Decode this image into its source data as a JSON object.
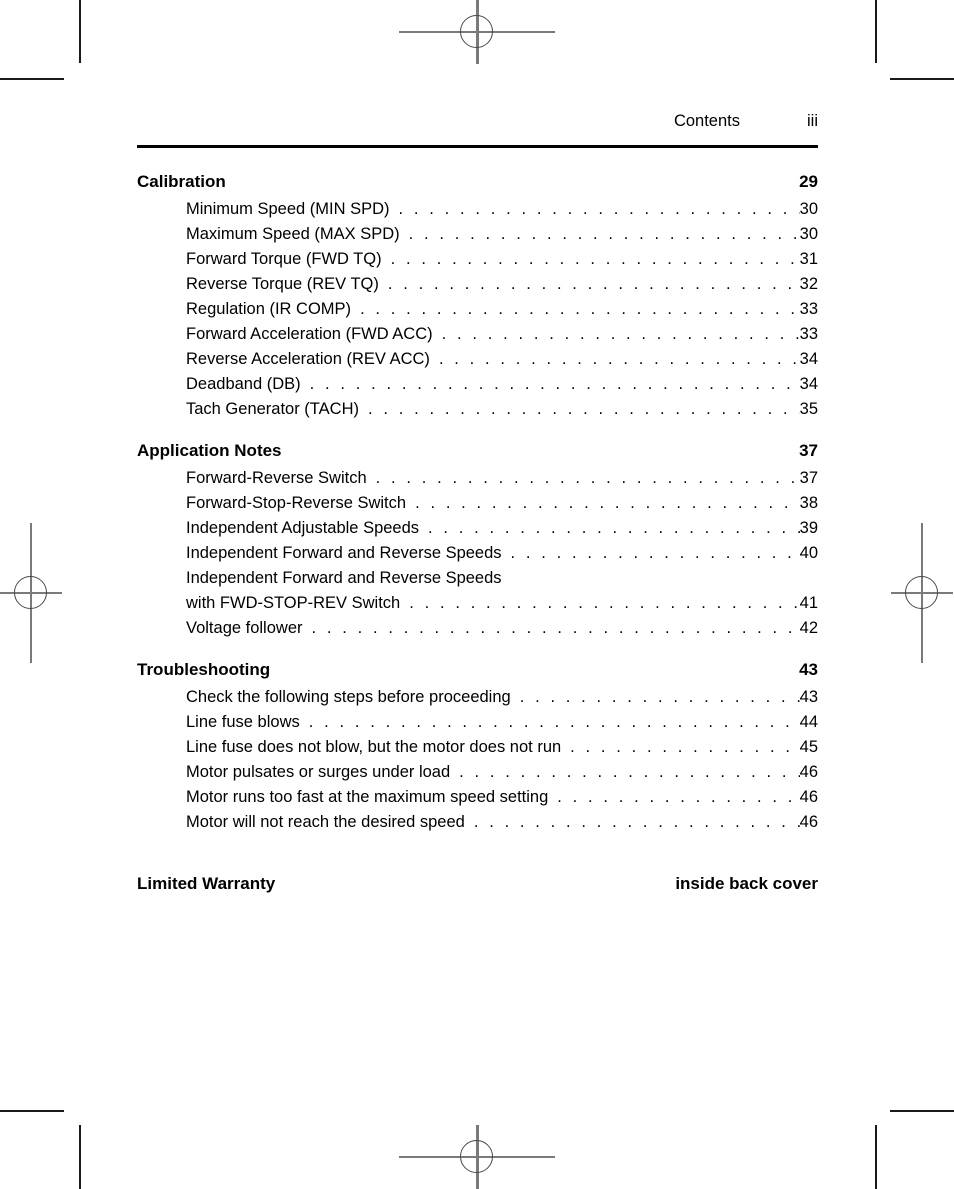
{
  "running_head": {
    "title": "Contents",
    "folio": "iii"
  },
  "sections": [
    {
      "title": "Calibration",
      "page": "29",
      "entries": [
        {
          "label": "Minimum Speed (MIN SPD)",
          "page": "30",
          "leader": true,
          "continuation": false
        },
        {
          "label": "Maximum Speed (MAX SPD)",
          "page": "30",
          "leader": true,
          "continuation": false
        },
        {
          "label": "Forward Torque (FWD TQ)",
          "page": "31",
          "leader": true,
          "continuation": false
        },
        {
          "label": "Reverse Torque (REV TQ)",
          "page": "32",
          "leader": true,
          "continuation": false
        },
        {
          "label": "Regulation (IR COMP)",
          "page": "33",
          "leader": true,
          "continuation": false
        },
        {
          "label": "Forward Acceleration (FWD ACC)",
          "page": "33",
          "leader": true,
          "continuation": false
        },
        {
          "label": "Reverse Acceleration (REV ACC)",
          "page": "34",
          "leader": true,
          "continuation": false
        },
        {
          "label": "Deadband (DB)",
          "page": "34",
          "leader": true,
          "continuation": false
        },
        {
          "label": "Tach Generator (TACH)",
          "page": "35",
          "leader": true,
          "continuation": false
        }
      ]
    },
    {
      "title": "Application Notes",
      "page": "37",
      "entries": [
        {
          "label": "Forward-Reverse Switch",
          "page": "37",
          "leader": true,
          "continuation": false
        },
        {
          "label": "Forward-Stop-Reverse Switch",
          "page": "38",
          "leader": true,
          "continuation": false
        },
        {
          "label": "Independent Adjustable Speeds",
          "page": "39",
          "leader": true,
          "continuation": false
        },
        {
          "label": "Independent Forward and Reverse Speeds",
          "page": "40",
          "leader": true,
          "continuation": false
        },
        {
          "label": "Independent Forward and Reverse Speeds",
          "page": "",
          "leader": false,
          "continuation": false
        },
        {
          "label": "with FWD-STOP-REV Switch",
          "page": "41",
          "leader": true,
          "continuation": true
        },
        {
          "label": "Voltage follower",
          "page": "42",
          "leader": true,
          "continuation": false
        }
      ]
    },
    {
      "title": "Troubleshooting",
      "page": "43",
      "entries": [
        {
          "label": "Check the following steps before proceeding",
          "page": "43",
          "leader": true,
          "continuation": false
        },
        {
          "label": "Line fuse blows",
          "page": "44",
          "leader": true,
          "continuation": false
        },
        {
          "label": "Line fuse does not blow, but the motor does not run",
          "page": "45",
          "leader": true,
          "continuation": false
        },
        {
          "label": "Motor pulsates or surges under load",
          "page": "46",
          "leader": true,
          "continuation": false
        },
        {
          "label": "Motor runs too fast at the maximum speed setting",
          "page": "46",
          "leader": true,
          "continuation": false
        },
        {
          "label": "Motor will not reach the desired speed",
          "page": "46",
          "leader": true,
          "continuation": false
        }
      ]
    }
  ],
  "tail": {
    "title": "Limited Warranty",
    "page": "inside back cover"
  },
  "print_marks": {
    "crop_color": "#1a1a1a",
    "registration_color": "#7a7a7a",
    "ring_color": "#4a4a4a"
  }
}
